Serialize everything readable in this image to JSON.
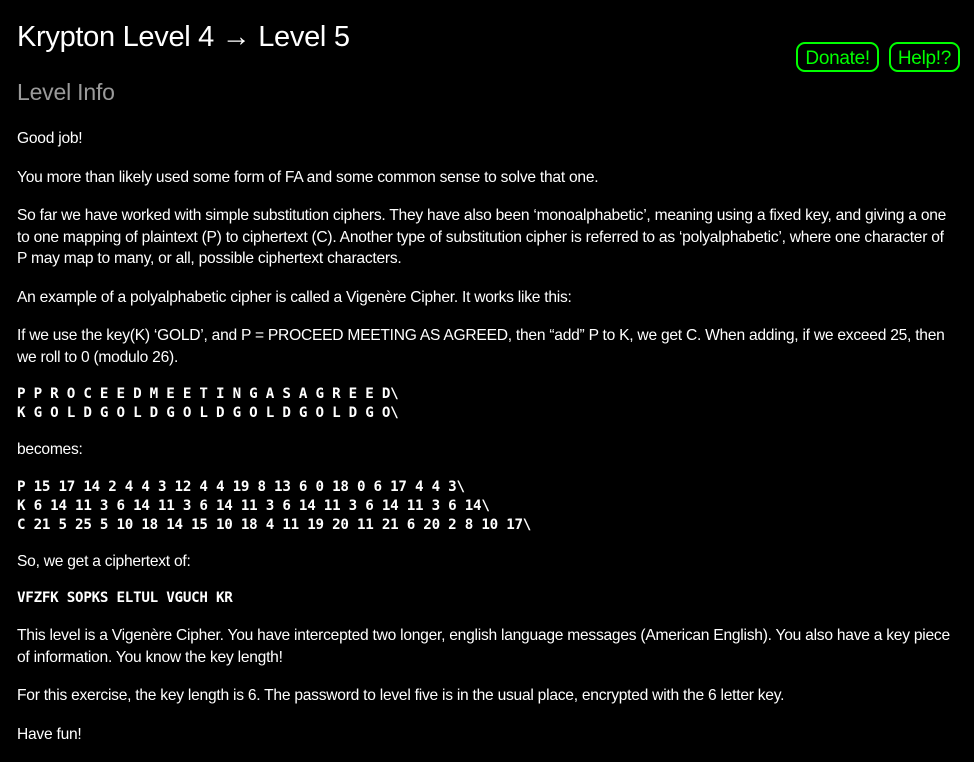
{
  "header": {
    "title": "Krypton Level 4 → Level 5",
    "donate_label": "Donate!",
    "help_label": "Help!?"
  },
  "section": {
    "heading": "Level Info"
  },
  "content": {
    "p1": "Good job!",
    "p2": "You more than likely used some form of FA and some common sense to solve that one.",
    "p3": "So far we have worked with simple substitution ciphers. They have also been ‘monoalphabetic’, meaning using a fixed key, and giving a one to one mapping of plaintext (P) to ciphertext (C). Another type of substitution cipher is referred to as ‘polyalphabetic’, where one character of P may map to many, or all, possible ciphertext characters.",
    "p4": "An example of a polyalphabetic cipher is called a Vigenère Cipher. It works like this:",
    "p5": "If we use the key(K) ‘GOLD’, and P = PROCEED MEETING AS AGREED, then “add” P to K, we get C. When adding, if we exceed 25, then we roll to 0 (modulo 26).",
    "code1": "P P R O C E E D M E E T I N G A S A G R E E D\\\nK G O L D G O L D G O L D G O L D G O L D G O\\",
    "p6": "becomes:",
    "code2": "P 15 17 14 2 4 4 3 12 4 4 19 8 13 6 0 18 0 6 17 4 4 3\\\nK 6 14 11 3 6 14 11 3 6 14 11 3 6 14 11 3 6 14 11 3 6 14\\\nC 21 5 25 5 10 18 14 15 10 18 4 11 19 20 11 21 6 20 2 8 10 17\\",
    "p7": "So, we get a ciphertext of:",
    "code3": "VFZFK SOPKS ELTUL VGUCH KR",
    "p8": "This level is a Vigenère Cipher. You have intercepted two longer, english language messages (American English). You also have a key piece of information. You know the key length!",
    "p9": "For this exercise, the key length is 6. The password to level five is in the usual place, encrypted with the 6 letter key.",
    "p10": "Have fun!"
  },
  "colors": {
    "background": "#000000",
    "text": "#ffffff",
    "heading_gray": "#9a9a9a",
    "accent_green": "#00ff00"
  }
}
